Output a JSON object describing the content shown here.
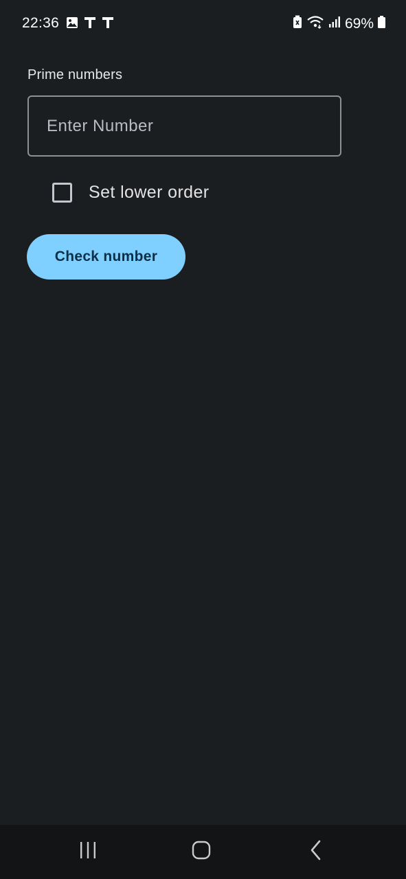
{
  "status_bar": {
    "time": "22:36",
    "left_icons": [
      "image-icon",
      "t-letter-icon",
      "t-letter-icon"
    ],
    "right_icons": [
      "battery-saver-icon",
      "wifi-icon",
      "signal-icon",
      "battery-icon"
    ],
    "battery_percent": "69%"
  },
  "main": {
    "title": "Prime numbers",
    "number_input": {
      "placeholder": "Enter Number",
      "value": ""
    },
    "lower_order_checkbox": {
      "label": "Set lower order",
      "checked": false
    },
    "check_button_label": "Check number"
  },
  "colors": {
    "background": "#1b1e21",
    "accent_button": "#7fd0ff",
    "button_text": "#0b2f48",
    "nav_bar": "#121416"
  },
  "nav_bar": {
    "icons": [
      "recents-icon",
      "home-icon",
      "back-icon"
    ]
  }
}
